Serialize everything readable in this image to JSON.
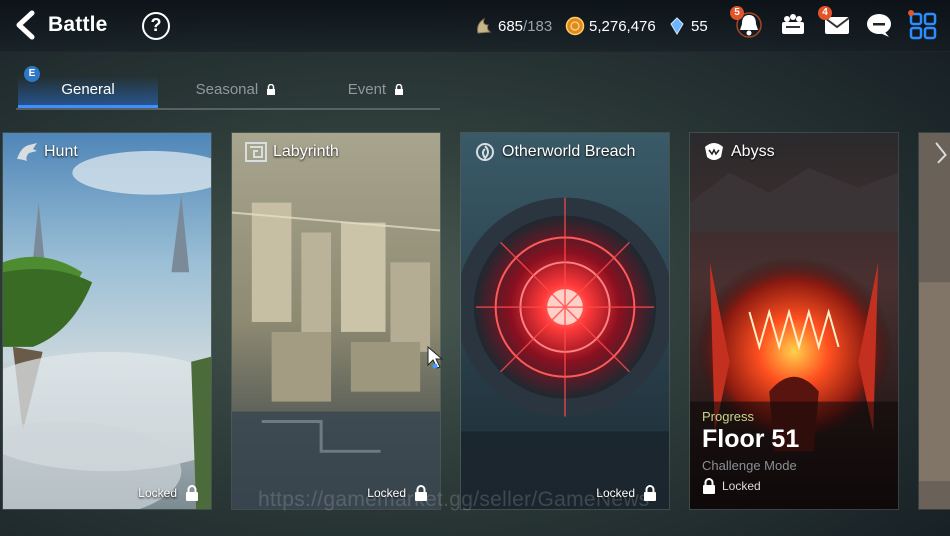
{
  "header": {
    "title": "Battle",
    "help_label": "?",
    "stamina": {
      "value": "685",
      "max": "/183"
    },
    "gold": "5,276,476",
    "crystals": "55",
    "notifications_badge": "5",
    "mail_badge": "4"
  },
  "tabs": {
    "badge": "E",
    "items": [
      {
        "label": "General",
        "state": "active"
      },
      {
        "label": "Seasonal",
        "state": "locked"
      },
      {
        "label": "Event",
        "state": "locked"
      }
    ]
  },
  "cards": [
    {
      "title": "Hunt",
      "status": "Locked",
      "icon": "dragon-icon"
    },
    {
      "title": "Labyrinth",
      "status": "Locked",
      "icon": "maze-icon"
    },
    {
      "title": "Otherworld Breach",
      "status": "Locked",
      "icon": "portal-icon"
    },
    {
      "title": "Abyss",
      "icon": "abyss-icon",
      "progress_label": "Progress",
      "floor": "Floor 51",
      "mode": "Challenge Mode",
      "status": "Locked"
    }
  ],
  "watermark": "https://gamemarket.gg/seller/GameNews",
  "colors": {
    "accent_blue": "#3f8fff",
    "badge_orange": "#e2552a",
    "progress_green": "#c8d48a"
  }
}
